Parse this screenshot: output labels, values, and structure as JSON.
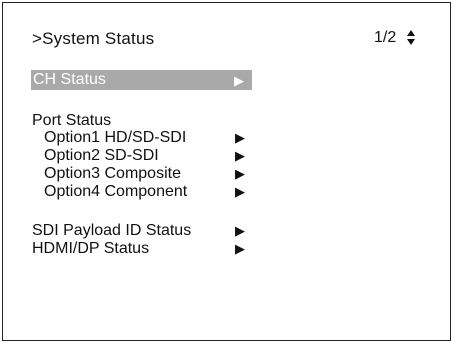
{
  "header": {
    "title": ">System Status",
    "page_indicator": "1/2"
  },
  "menu": {
    "ch_status": "CH Status",
    "port_status_heading": "Port Status",
    "port_items": [
      "Option1 HD/SD-SDI",
      "Option2 SD-SDI",
      "Option3 Composite",
      "Option4 Component"
    ],
    "sdi_payload": "SDI Payload ID Status",
    "hdmi_dp": "HDMI/DP Status"
  },
  "icons": {
    "submenu_arrow": "right-triangle-icon",
    "page_scroll": "up-down-arrows-icon"
  },
  "colors": {
    "highlight": "#a9a9a9",
    "highlight_text": "#ffffff"
  }
}
